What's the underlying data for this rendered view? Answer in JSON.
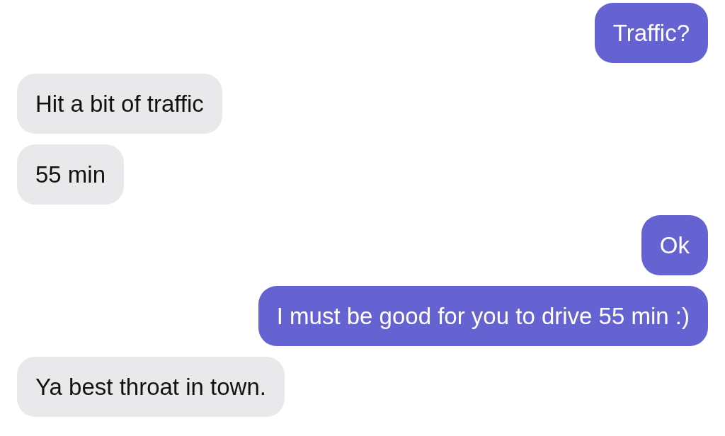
{
  "messages": [
    {
      "kind": "sent",
      "text": "Traffic?"
    },
    {
      "kind": "received",
      "text": "Hit a bit of traffic"
    },
    {
      "kind": "received",
      "text": "55 min"
    },
    {
      "kind": "sent",
      "text": "Ok"
    },
    {
      "kind": "sent",
      "text": "I must be good for you to drive 55 min :)"
    },
    {
      "kind": "received",
      "text": "Ya best throat in town."
    }
  ]
}
